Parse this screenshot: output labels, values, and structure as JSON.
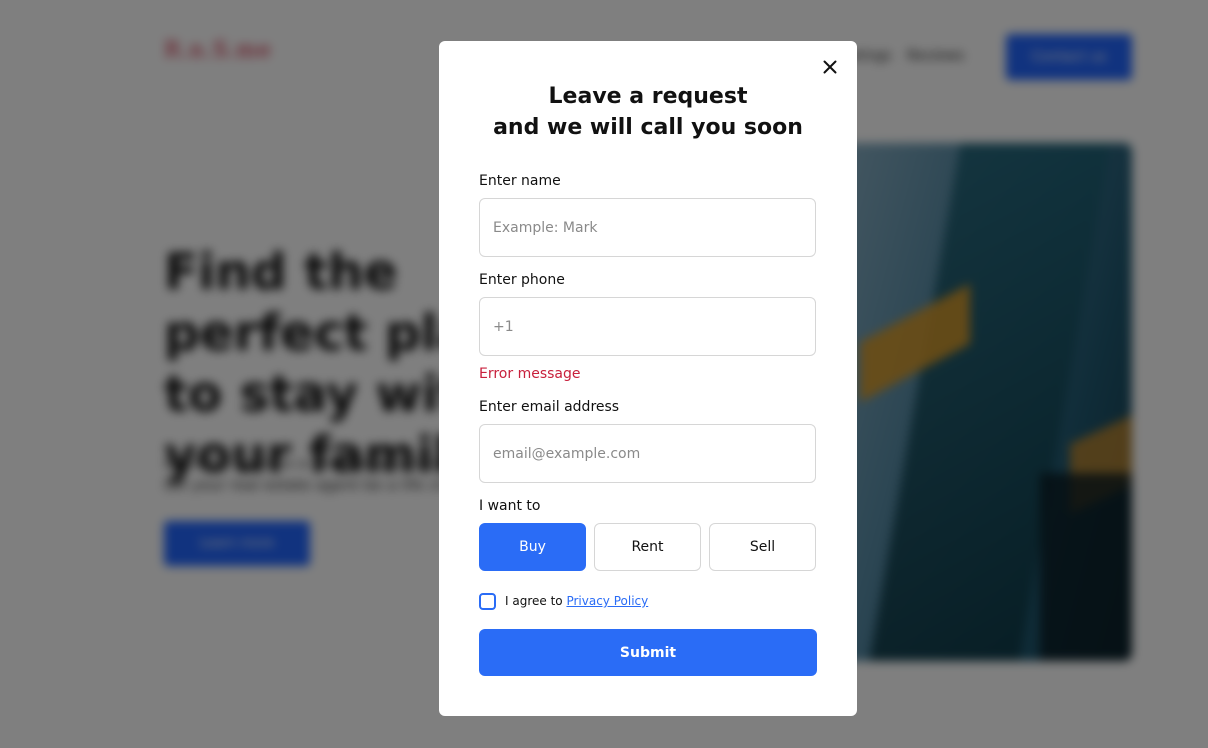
{
  "background": {
    "logo": "R.n.S.me",
    "nav": [
      "Listings",
      "Reviews"
    ],
    "contact_label": "Contact us",
    "hero_title": "Find the perfect place to stay with your family",
    "hero_subtitle": "Buying a home is a life-changing experience. Let your real estate agent be a life changer.",
    "hero_button": "Learn more"
  },
  "modal": {
    "title_line1": "Leave a request",
    "title_line2": "and we will call you soon",
    "name": {
      "label": "Enter name",
      "placeholder": "Example: Mark"
    },
    "phone": {
      "label": "Enter phone",
      "placeholder": "+1",
      "error": "Error message"
    },
    "email": {
      "label": "Enter email address",
      "placeholder": "email@example.com"
    },
    "intent": {
      "label": "I want to",
      "options": [
        "Buy",
        "Rent",
        "Sell"
      ],
      "selected": "Buy"
    },
    "agree": {
      "text": "I agree to",
      "link": "Privacy Policy",
      "checked": false
    },
    "submit_label": "Submit"
  },
  "colors": {
    "accent": "#2a6cf6",
    "error": "#c8203c",
    "overlay": "rgba(0,0,0,0.5)"
  }
}
